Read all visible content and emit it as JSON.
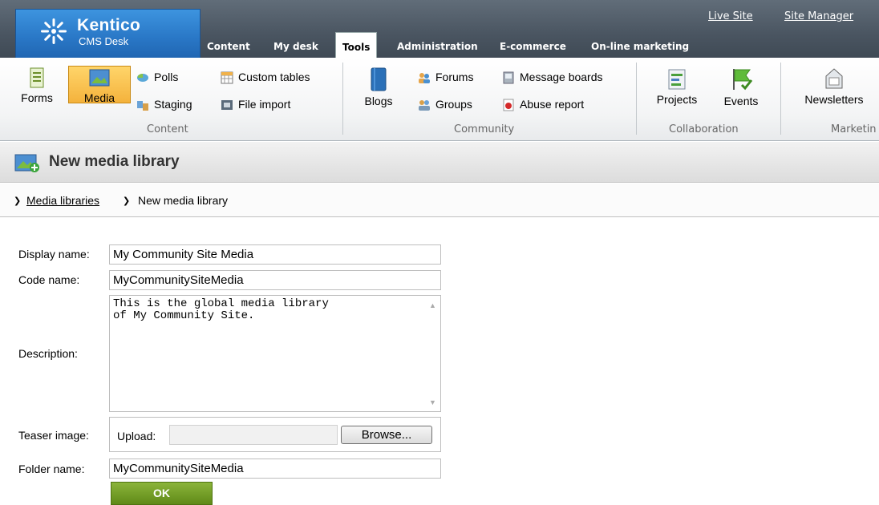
{
  "header": {
    "brand": "Kentico",
    "product": "CMS Desk",
    "links": [
      "Live Site",
      "Site Manager"
    ],
    "tabs": [
      "Content",
      "My desk",
      "Tools",
      "Administration",
      "E-commerce",
      "On-line marketing"
    ],
    "active_tab": "Tools"
  },
  "ribbon": {
    "content": {
      "forms": "Forms",
      "media": "Media",
      "polls": "Polls",
      "staging": "Staging",
      "custom_tables": "Custom tables",
      "file_import": "File import",
      "label": "Content"
    },
    "community": {
      "blogs": "Blogs",
      "forums": "Forums",
      "groups": "Groups",
      "message_boards": "Message boards",
      "abuse_report": "Abuse report",
      "label": "Community"
    },
    "collaboration": {
      "projects": "Projects",
      "events": "Events",
      "label": "Collaboration"
    },
    "marketing": {
      "newsletters": "Newsletters",
      "label": "Marketin"
    }
  },
  "page": {
    "title": "New media library"
  },
  "breadcrumb": {
    "parent": "Media libraries",
    "current": "New media library"
  },
  "form": {
    "display_name_label": "Display name:",
    "display_name_value": "My Community Site Media",
    "code_name_label": "Code name:",
    "code_name_value": "MyCommunitySiteMedia",
    "description_label": "Description:",
    "description_value": "This is the global media library\nof My Community Site.",
    "teaser_label": "Teaser image:",
    "upload_label": "Upload:",
    "browse_label": "Browse...",
    "folder_label": "Folder name:",
    "folder_value": "MyCommunitySiteMedia",
    "ok_label": "OK"
  }
}
